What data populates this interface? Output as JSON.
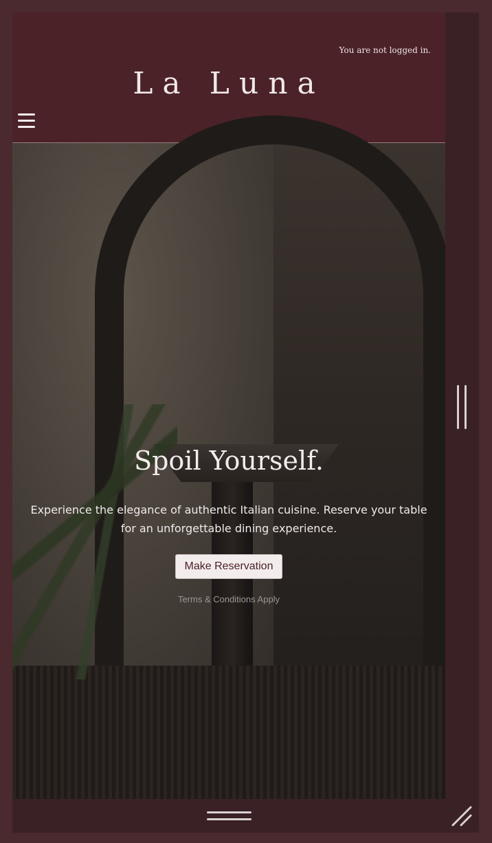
{
  "header": {
    "login_status": "You are not logged in.",
    "brand": "La Luna",
    "menu_icon": "hamburger-menu-icon"
  },
  "hero": {
    "title": "Spoil Yourself.",
    "subtitle": "Experience the elegance of authentic Italian cuisine. Reserve your table for an unforgettable dining experience.",
    "cta_label": "Make Reservation",
    "terms": "Terms & Conditions Apply"
  },
  "window": {
    "scroll_handle_icon": "vertical-drag-handle-icon",
    "bottom_handle_icon": "horizontal-drag-handle-icon",
    "resize_icon": "resize-corner-icon"
  },
  "colors": {
    "page_background": "#4a2a2f",
    "header_background": "#4a2227",
    "button_text": "#4a2227"
  }
}
